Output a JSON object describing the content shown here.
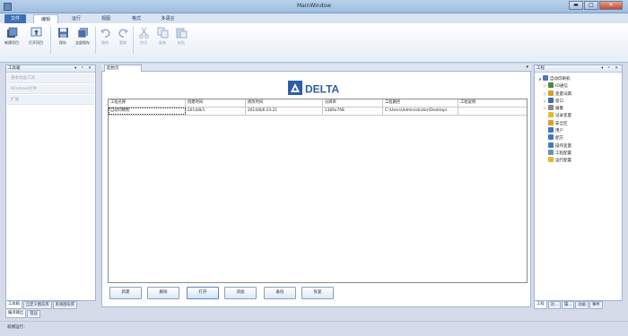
{
  "window": {
    "title": "MainWindow",
    "minimize": "▬",
    "maximize": "□",
    "close": "✕"
  },
  "menu_tabs": [
    "文件",
    "编辑",
    "运行",
    "视图",
    "格式",
    "多语言"
  ],
  "ribbon": {
    "buttons": [
      {
        "label": "新建项目",
        "icon": "new-project-icon"
      },
      {
        "label": "打开项目",
        "icon": "open-project-icon"
      },
      {
        "label": "保存",
        "icon": "save-icon"
      },
      {
        "label": "全部保存",
        "icon": "save-all-icon"
      },
      {
        "label": "撤销",
        "icon": "undo-icon"
      },
      {
        "label": "重做",
        "icon": "redo-icon"
      },
      {
        "label": "剪切",
        "icon": "cut-icon"
      },
      {
        "label": "复制",
        "icon": "copy-icon"
      },
      {
        "label": "粘贴",
        "icon": "paste-icon"
      }
    ]
  },
  "toolbox": {
    "title": "工具箱",
    "controls": "▾ ᵖ ✕",
    "items": [
      "基本绘画工具",
      "Windows控件",
      "扩展"
    ],
    "bottom_tabs": [
      "工具箱",
      "自定义图形库",
      "系统图形库"
    ]
  },
  "center": {
    "tab": "起始页",
    "dropdown": "▾",
    "logo_text": "DELTA",
    "table": {
      "columns": [
        "工程名称",
        "创建时间",
        "修改时间",
        "分辨率",
        "工程路径",
        "工程说明"
      ],
      "rows": [
        [
          "自动印刷机",
          "2014/8/1",
          "2014/8/6 23:21",
          "1366x768",
          "C:\\Users\\Administrator\\Desktop\\",
          ""
        ]
      ]
    },
    "buttons": [
      "新建",
      "删除",
      "打开",
      "添加",
      "备份",
      "恢复"
    ]
  },
  "project": {
    "title": "工程",
    "controls": "▾ ᵖ ✕",
    "tree": [
      {
        "label": "自动印刷机",
        "toggle": "◢",
        "color": "#4a78b8",
        "level": 0
      },
      {
        "label": "IO通信",
        "toggle": "▷",
        "color": "#4c8a3c",
        "level": 1
      },
      {
        "label": "变量词典",
        "toggle": "▷",
        "color": "#d8a21e",
        "level": 1
      },
      {
        "label": "窗口",
        "toggle": "▷",
        "color": "#3a6bb0",
        "level": 1
      },
      {
        "label": "报警",
        "toggle": "▷",
        "color": "#8a8a8a",
        "level": 1
      },
      {
        "label": "记录变量",
        "toggle": "",
        "color": "#e6b82a",
        "level": 1
      },
      {
        "label": "安全区",
        "toggle": "",
        "color": "#e0a020",
        "level": 1
      },
      {
        "label": "用户",
        "toggle": "",
        "color": "#3f74c2",
        "level": 1
      },
      {
        "label": "配方",
        "toggle": "",
        "color": "#3f74c2",
        "level": 1
      },
      {
        "label": "操作变量",
        "toggle": "",
        "color": "#4a78b8",
        "level": 1
      },
      {
        "label": "工程配置",
        "toggle": "",
        "color": "#6e8fb8",
        "level": 1
      },
      {
        "label": "运行配置",
        "toggle": "",
        "color": "#e6b82a",
        "level": 1
      }
    ],
    "bottom_tabs": [
      "工程",
      "对...",
      "属...",
      "动画",
      "事件"
    ]
  },
  "output_tabs": [
    "编译输出",
    "错误"
  ],
  "status": "就绪运行："
}
